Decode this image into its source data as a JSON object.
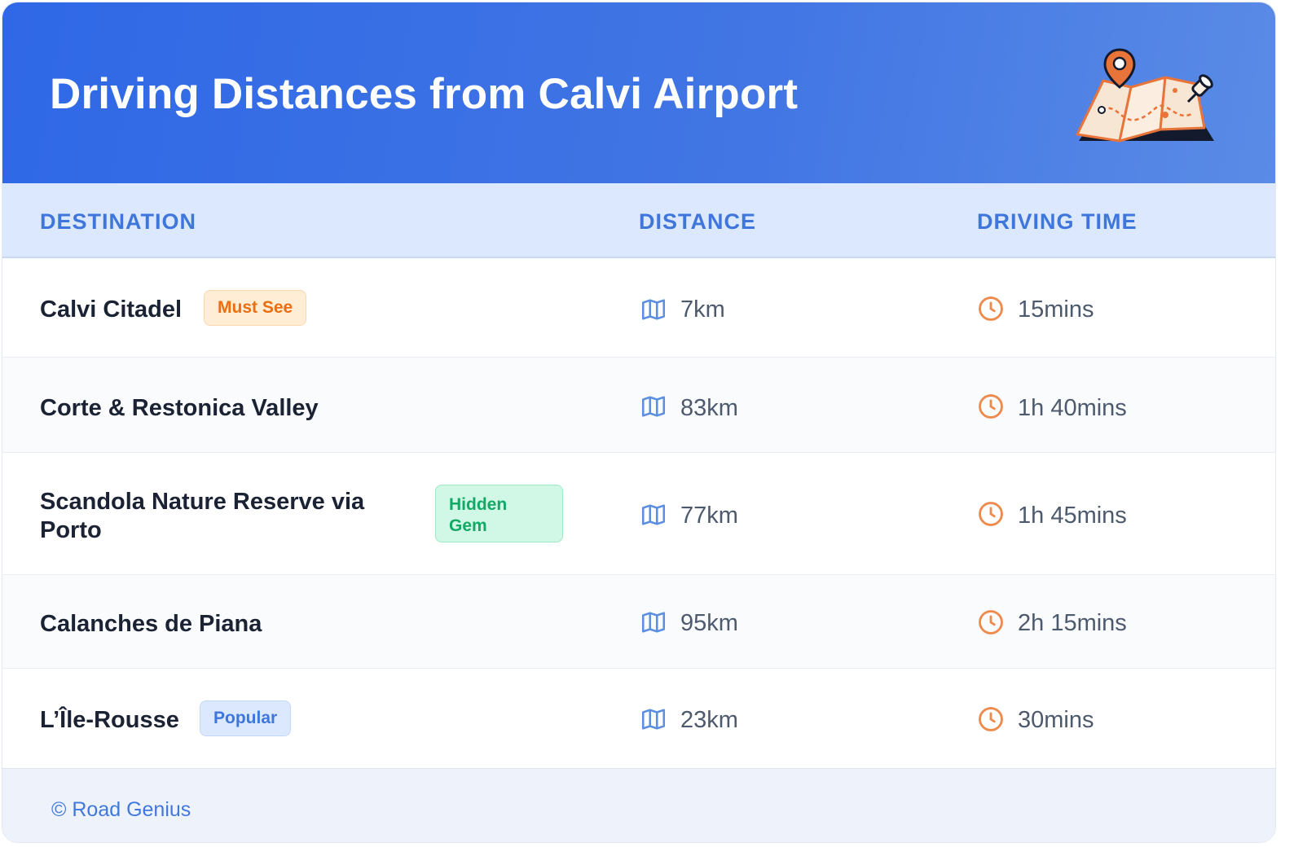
{
  "header": {
    "title": "Driving Distances from Calvi Airport",
    "illustration": "map-with-pins-icon"
  },
  "columns": {
    "destination": "DESTINATION",
    "distance": "DISTANCE",
    "driving_time": "DRIVING TIME"
  },
  "rows": [
    {
      "destination": "Calvi Citadel",
      "badge": "Must See",
      "badge_type": "must-see",
      "distance": "7km",
      "time": "15mins"
    },
    {
      "destination": "Corte & Restonica Valley",
      "badge": "",
      "badge_type": "",
      "distance": "83km",
      "time": "1h 40mins"
    },
    {
      "destination": "Scandola Nature Reserve via Porto",
      "badge": "Hidden Gem",
      "badge_type": "hidden-gem",
      "distance": "77km",
      "time": "1h 45mins"
    },
    {
      "destination": "Calanches de Piana",
      "badge": "",
      "badge_type": "",
      "distance": "95km",
      "time": "2h 15mins"
    },
    {
      "destination": "L’Île-Rousse",
      "badge": "Popular",
      "badge_type": "popular",
      "distance": "23km",
      "time": "30mins"
    }
  ],
  "icons": {
    "distance": "map-icon",
    "time": "clock-icon"
  },
  "footer": {
    "text": "© Road Genius"
  },
  "colors": {
    "header_start": "#2f68e6",
    "header_end": "#5a8be6",
    "column_header_bg": "#dbe8fd",
    "accent_blue": "#3f76dc",
    "accent_orange": "#ea6e12",
    "accent_green": "#12a866"
  }
}
